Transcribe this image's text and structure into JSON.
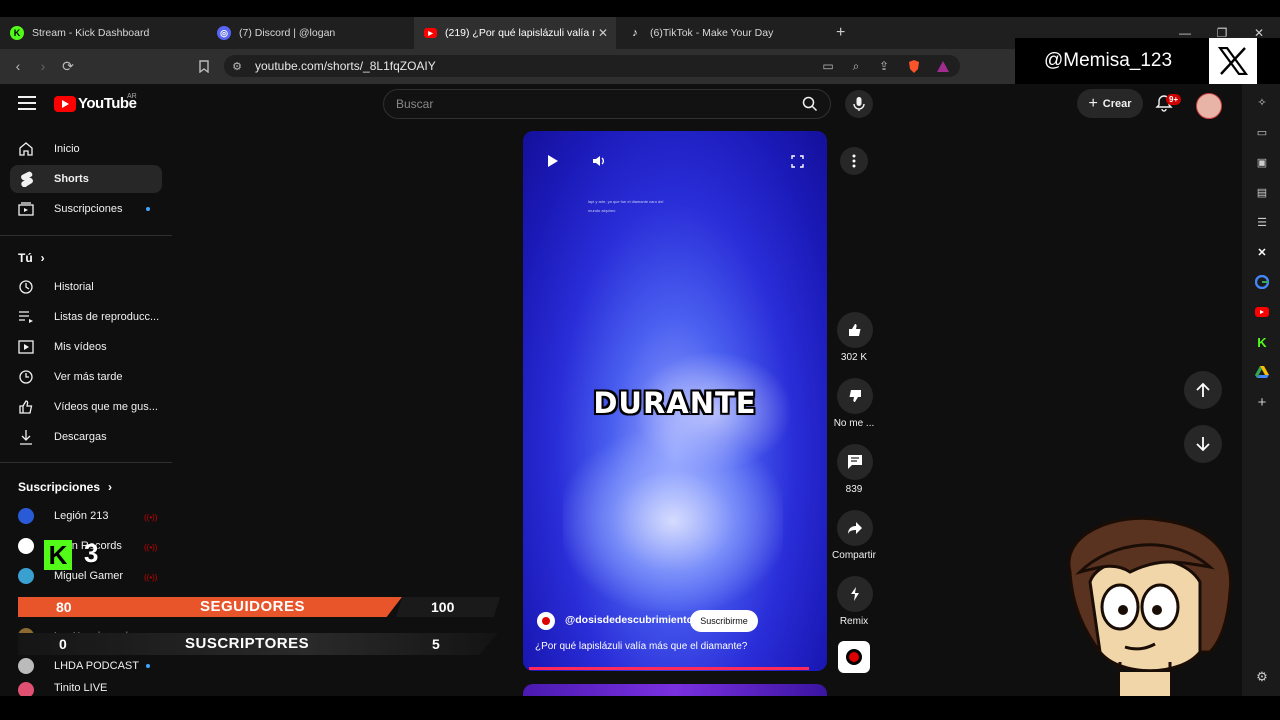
{
  "browser": {
    "tabs": [
      {
        "title": "Stream - Kick Dashboard",
        "icon": "kick-icon",
        "color": "#53fc18"
      },
      {
        "title": "(7) Discord | @logan",
        "icon": "discord-icon",
        "color": "#5865f2"
      },
      {
        "title": "(219) ¿Por qué lapislázuli valía m",
        "icon": "youtube-icon",
        "color": "#ff0000"
      },
      {
        "title": "(6)TikTok - Make Your Day",
        "icon": "tiktok-icon",
        "color": "#ffffff"
      }
    ],
    "new_tab": "+",
    "url": "youtube.com/shorts/_8L1fqZOAIY"
  },
  "overlay": {
    "handle": "@Memisa_123",
    "followers_current": "80",
    "followers_label": "SEGUIDORES",
    "followers_goal": "100",
    "subscribers_current": "0",
    "subscribers_label": "SUSCRIPTORES",
    "subscribers_goal": "5",
    "kick_letter": "K",
    "kick_count": "3"
  },
  "youtube": {
    "logo_text": "YouTube",
    "country": "AR",
    "search_placeholder": "Buscar",
    "create_label": "Crear",
    "notif_badge": "9+"
  },
  "sidebar": {
    "main": [
      {
        "label": "Inicio",
        "icon": "home-icon"
      },
      {
        "label": "Shorts",
        "icon": "shorts-icon"
      },
      {
        "label": "Suscripciones",
        "icon": "subscriptions-icon"
      }
    ],
    "you_header": "Tú",
    "you": [
      {
        "label": "Historial",
        "icon": "history-icon"
      },
      {
        "label": "Listas de reproducc...",
        "icon": "playlist-icon"
      },
      {
        "label": "Mis vídeos",
        "icon": "my-videos-icon"
      },
      {
        "label": "Ver más tarde",
        "icon": "watch-later-icon"
      },
      {
        "label": "Vídeos que me gus...",
        "icon": "liked-icon"
      },
      {
        "label": "Descargas",
        "icon": "download-icon"
      }
    ],
    "subs_header": "Suscripciones",
    "subs": [
      {
        "label": "Legión 213",
        "color": "#2a5bd7"
      },
      {
        "label": "...nin Records",
        "color": "#ffffff"
      },
      {
        "label": "Miguel Gamer",
        "color": "#3aa0d0"
      },
      {
        "label": "",
        "color": "#dddddd"
      },
      {
        "label": "Los Herederos d...",
        "color": "#8a6a30"
      },
      {
        "label": "LHDA PODCAST",
        "color": "#bbbbbb"
      },
      {
        "label": "Tinito LIVE",
        "color": "#e05070"
      }
    ]
  },
  "short": {
    "caption": "DURANTE",
    "tiny_overlay_text": "lapi y arte, ya que fue el diamante caro del mundo alquimo",
    "channel": "@dosisdedescubrimiento",
    "subscribe_label": "Suscribirme",
    "title": "¿Por qué lapislázuli valía más que el diamante?",
    "progress": 0.96
  },
  "actions": [
    {
      "label": "302 K",
      "icon": "like-icon"
    },
    {
      "label": "No me ...",
      "icon": "dislike-icon"
    },
    {
      "label": "839",
      "icon": "comment-icon"
    },
    {
      "label": "Compartir",
      "icon": "share-icon"
    },
    {
      "label": "Remix",
      "icon": "remix-icon"
    }
  ]
}
